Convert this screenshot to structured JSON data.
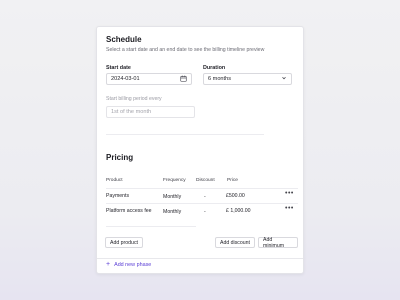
{
  "schedule": {
    "title": "Schedule",
    "description": "Select a start date and an end date to see the billing timeline preview",
    "start_date_label": "Start date",
    "start_date_value": "2024-03-01",
    "duration_label": "Duration",
    "duration_value": "6 months",
    "billing_label": "Start billing period every",
    "billing_value": "1st of the month"
  },
  "pricing": {
    "title": "Pricing",
    "columns": [
      "Product",
      "Frequency",
      "Discount",
      "Price"
    ],
    "rows": [
      {
        "product": "Payments",
        "frequency": "Monthly",
        "discount": "-",
        "price": "£500.00"
      },
      {
        "product": "Platform access fee",
        "frequency": "Monthly",
        "discount": "-",
        "price": "£ 1,000.00"
      }
    ],
    "add_product": "Add product",
    "add_discount": "Add discount",
    "add_minimum": "Add minimum"
  },
  "footer": {
    "add_phase": "Add new phase"
  },
  "colors": {
    "accent": "#5b3fd6"
  }
}
